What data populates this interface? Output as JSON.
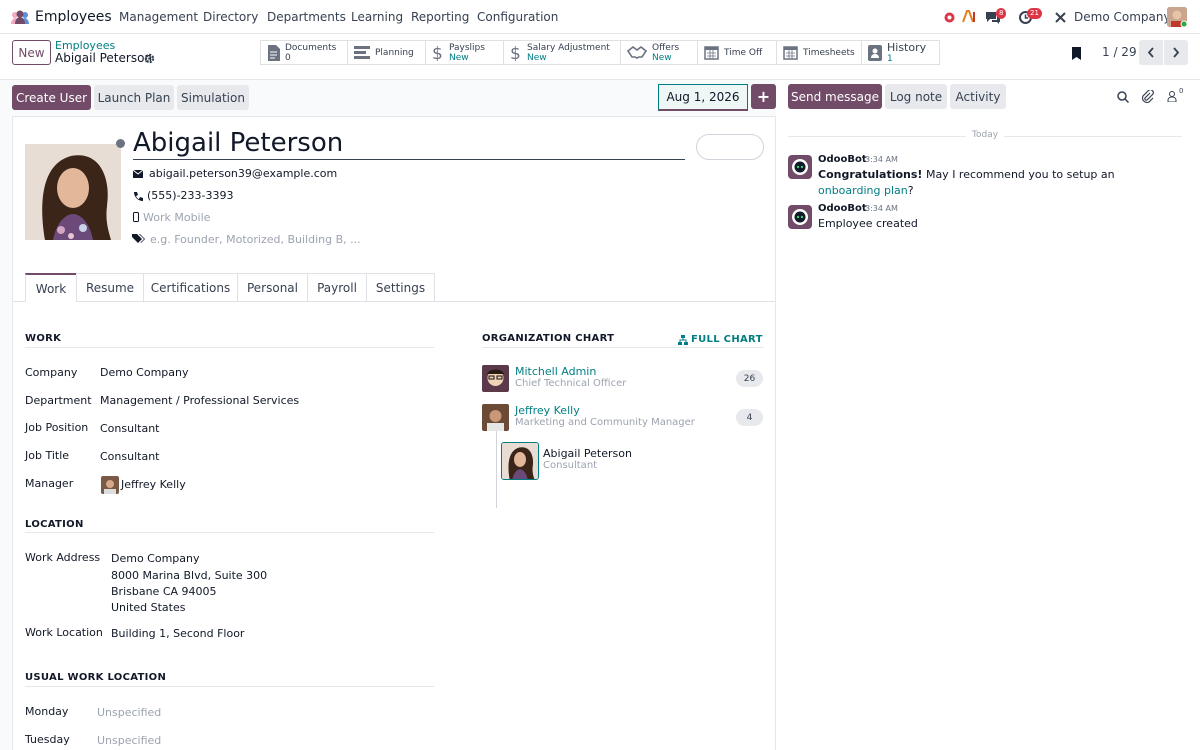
{
  "app": {
    "title": "Employees",
    "company": "Demo Company"
  },
  "nav": {
    "menu": [
      "Management",
      "Directory",
      "Departments",
      "Learning",
      "Reporting",
      "Configuration"
    ],
    "badges": {
      "messages": "8",
      "activities": "21"
    }
  },
  "control": {
    "new_label": "New",
    "breadcrumb_parent": "Employees",
    "breadcrumb_current": "Abigail Peterson",
    "pager": "1 / 29"
  },
  "smart_buttons": [
    {
      "label": "Documents",
      "sub": "0"
    },
    {
      "label": "Planning",
      "sub": ""
    },
    {
      "label": "Payslips",
      "sub": "New"
    },
    {
      "label": "Salary Adjustment",
      "sub": "New"
    },
    {
      "label": "Offers",
      "sub": "New"
    },
    {
      "label": "Time Off",
      "sub": ""
    },
    {
      "label": "Timesheets",
      "sub": ""
    },
    {
      "label": "History",
      "sub": "1"
    }
  ],
  "actions": {
    "create_user": "Create User",
    "launch_plan": "Launch Plan",
    "simulation": "Simulation",
    "date": "Aug 1, 2026",
    "plus": "+"
  },
  "employee": {
    "name": "Abigail Peterson",
    "email": "abigail.peterson39@example.com",
    "phone": "(555)-233-3393",
    "mobile_placeholder": "Work Mobile",
    "tags_placeholder": "e.g. Founder, Motorized, Building B, ..."
  },
  "tabs": [
    "Work",
    "Resume",
    "Certifications",
    "Personal",
    "Payroll",
    "Settings"
  ],
  "work": {
    "title": "WORK",
    "fields": [
      {
        "label": "Company",
        "value": "Demo Company"
      },
      {
        "label": "Department",
        "value": "Management / Professional Services"
      },
      {
        "label": "Job Position",
        "value": "Consultant"
      },
      {
        "label": "Job Title",
        "value": "Consultant"
      },
      {
        "label": "Manager",
        "value": "Jeffrey Kelly"
      }
    ]
  },
  "location": {
    "title": "LOCATION",
    "address_label": "Work Address",
    "address_lines": [
      "Demo Company",
      "8000 Marina Blvd, Suite 300",
      "Brisbane CA 94005",
      "United States"
    ],
    "work_location_label": "Work Location",
    "work_location": "Building 1, Second Floor"
  },
  "usual_location": {
    "title": "USUAL WORK LOCATION",
    "days": [
      {
        "label": "Monday",
        "value": "Unspecified"
      },
      {
        "label": "Tuesday",
        "value": "Unspecified"
      }
    ]
  },
  "org_chart": {
    "title": "ORGANIZATION CHART",
    "full_chart": "FULL CHART",
    "people": [
      {
        "name": "Mitchell Admin",
        "job": "Chief Technical Officer",
        "count": "26"
      },
      {
        "name": "Jeffrey Kelly",
        "job": "Marketing and Community Manager",
        "count": "4"
      },
      {
        "name": "Abigail Peterson",
        "job": "Consultant",
        "count": ""
      }
    ]
  },
  "chatter": {
    "send_message": "Send message",
    "log_note": "Log note",
    "activity": "Activity",
    "followers_count": "0",
    "today": "Today",
    "messages": [
      {
        "author": "OdooBot",
        "time": "3:34 AM",
        "bold": "Congratulations!",
        "text": " May I recommend you to setup an ",
        "link": "onboarding plan",
        "tail": "?"
      },
      {
        "author": "OdooBot",
        "time": "3:34 AM",
        "text": "Employee created"
      }
    ]
  },
  "colors": {
    "brand": "#714b67",
    "link": "#017e84",
    "badge": "#dc3545"
  }
}
